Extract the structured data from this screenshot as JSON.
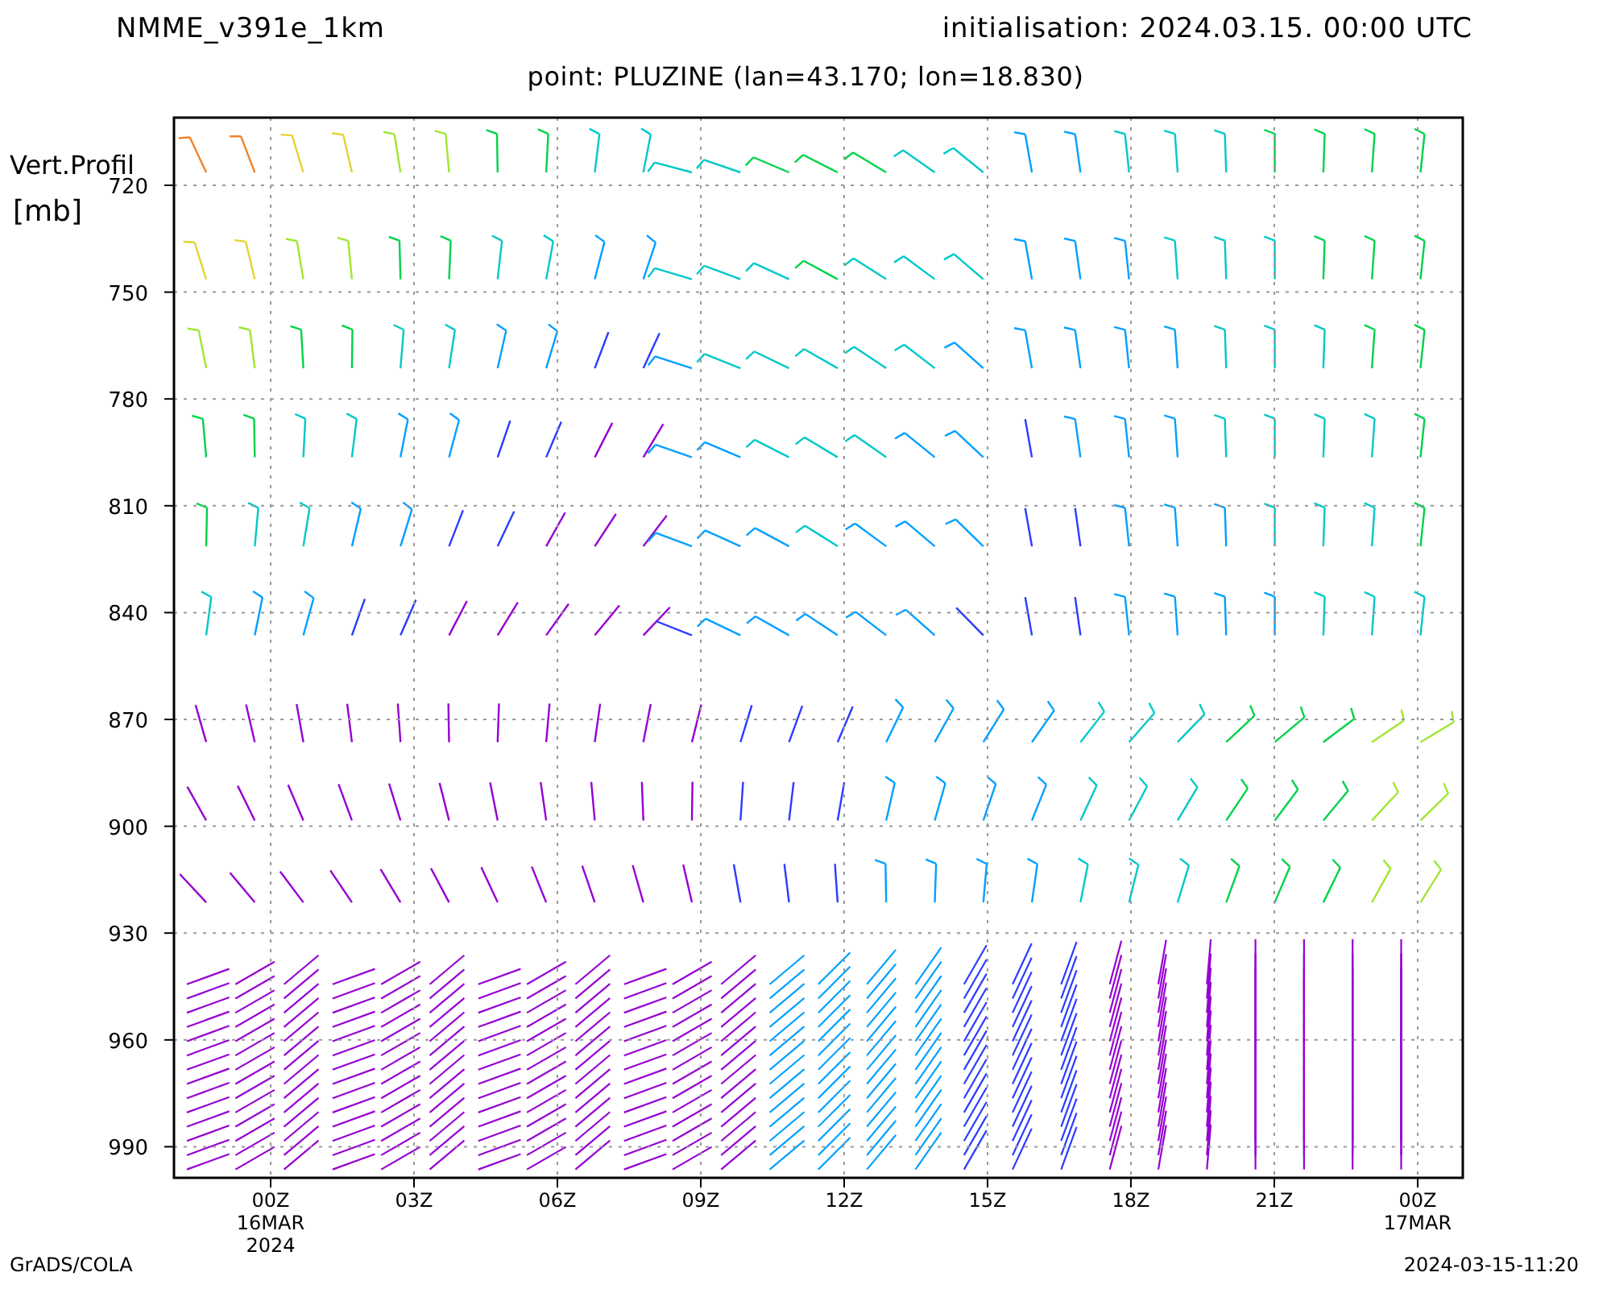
{
  "header": {
    "title": "NMME_v391e_1km",
    "initialisation": "initialisation: 2024.03.15. 00:00 UTC"
  },
  "subtitle": "point: PLUZINE (lan=43.170; lon=18.830)",
  "chart": {
    "ylabel_lines": [
      "Vert.Profil",
      "[mb]"
    ],
    "yticks": [
      "720",
      "750",
      "780",
      "810",
      "840",
      "870",
      "900",
      "930",
      "960",
      "990"
    ],
    "xticks": [
      {
        "lines": [
          "00Z",
          "16MAR",
          "2024"
        ]
      },
      {
        "lines": [
          "03Z"
        ]
      },
      {
        "lines": [
          "06Z"
        ]
      },
      {
        "lines": [
          "09Z"
        ]
      },
      {
        "lines": [
          "12Z"
        ]
      },
      {
        "lines": [
          "15Z"
        ]
      },
      {
        "lines": [
          "18Z"
        ]
      },
      {
        "lines": [
          "21Z"
        ]
      },
      {
        "lines": [
          "00Z",
          "17MAR"
        ]
      }
    ]
  },
  "footer": {
    "left": "GrADS/COLA",
    "right": "2024-03-15-11:20"
  }
}
